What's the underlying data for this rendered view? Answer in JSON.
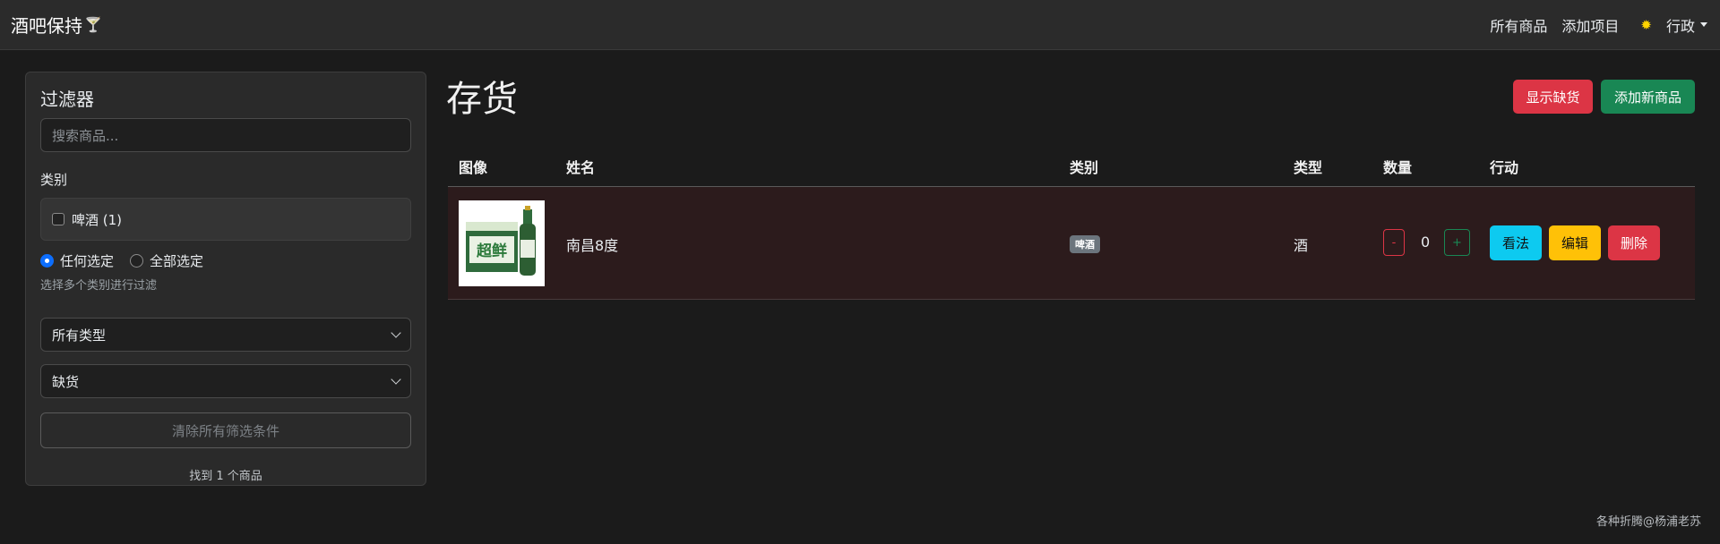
{
  "navbar": {
    "brand": "酒吧保持",
    "links": [
      "所有商品",
      "添加项目"
    ],
    "user": "行政"
  },
  "sidebar": {
    "title": "过滤器",
    "search_placeholder": "搜索商品...",
    "category_label": "类别",
    "categories": [
      {
        "label": "啤酒 (1)",
        "checked": false
      }
    ],
    "match_options": [
      "任何选定",
      "全部选定"
    ],
    "match_selected": "任何选定",
    "hint": "选择多个类别进行过滤",
    "type_select": "所有类型",
    "stock_select": "缺货",
    "clear_button": "清除所有筛选条件",
    "found_text": "找到 1 个商品"
  },
  "main": {
    "title": "存货",
    "show_low_button": "显示缺货",
    "add_new_button": "添加新商品",
    "columns": [
      "图像",
      "姓名",
      "类别",
      "类型",
      "数量",
      "行动"
    ],
    "rows": [
      {
        "name": "南昌8度",
        "category": "啤酒",
        "type": "酒",
        "quantity": "0",
        "actions": [
          "看法",
          "编辑",
          "删除"
        ],
        "image_text": "超鲜"
      }
    ]
  },
  "footer": "各种折腾@杨浦老苏",
  "colors": {
    "danger": "#dc3545",
    "success": "#198754",
    "info": "#0dcaf0",
    "warning": "#ffc107",
    "row_bg": "#2c1b1c"
  }
}
